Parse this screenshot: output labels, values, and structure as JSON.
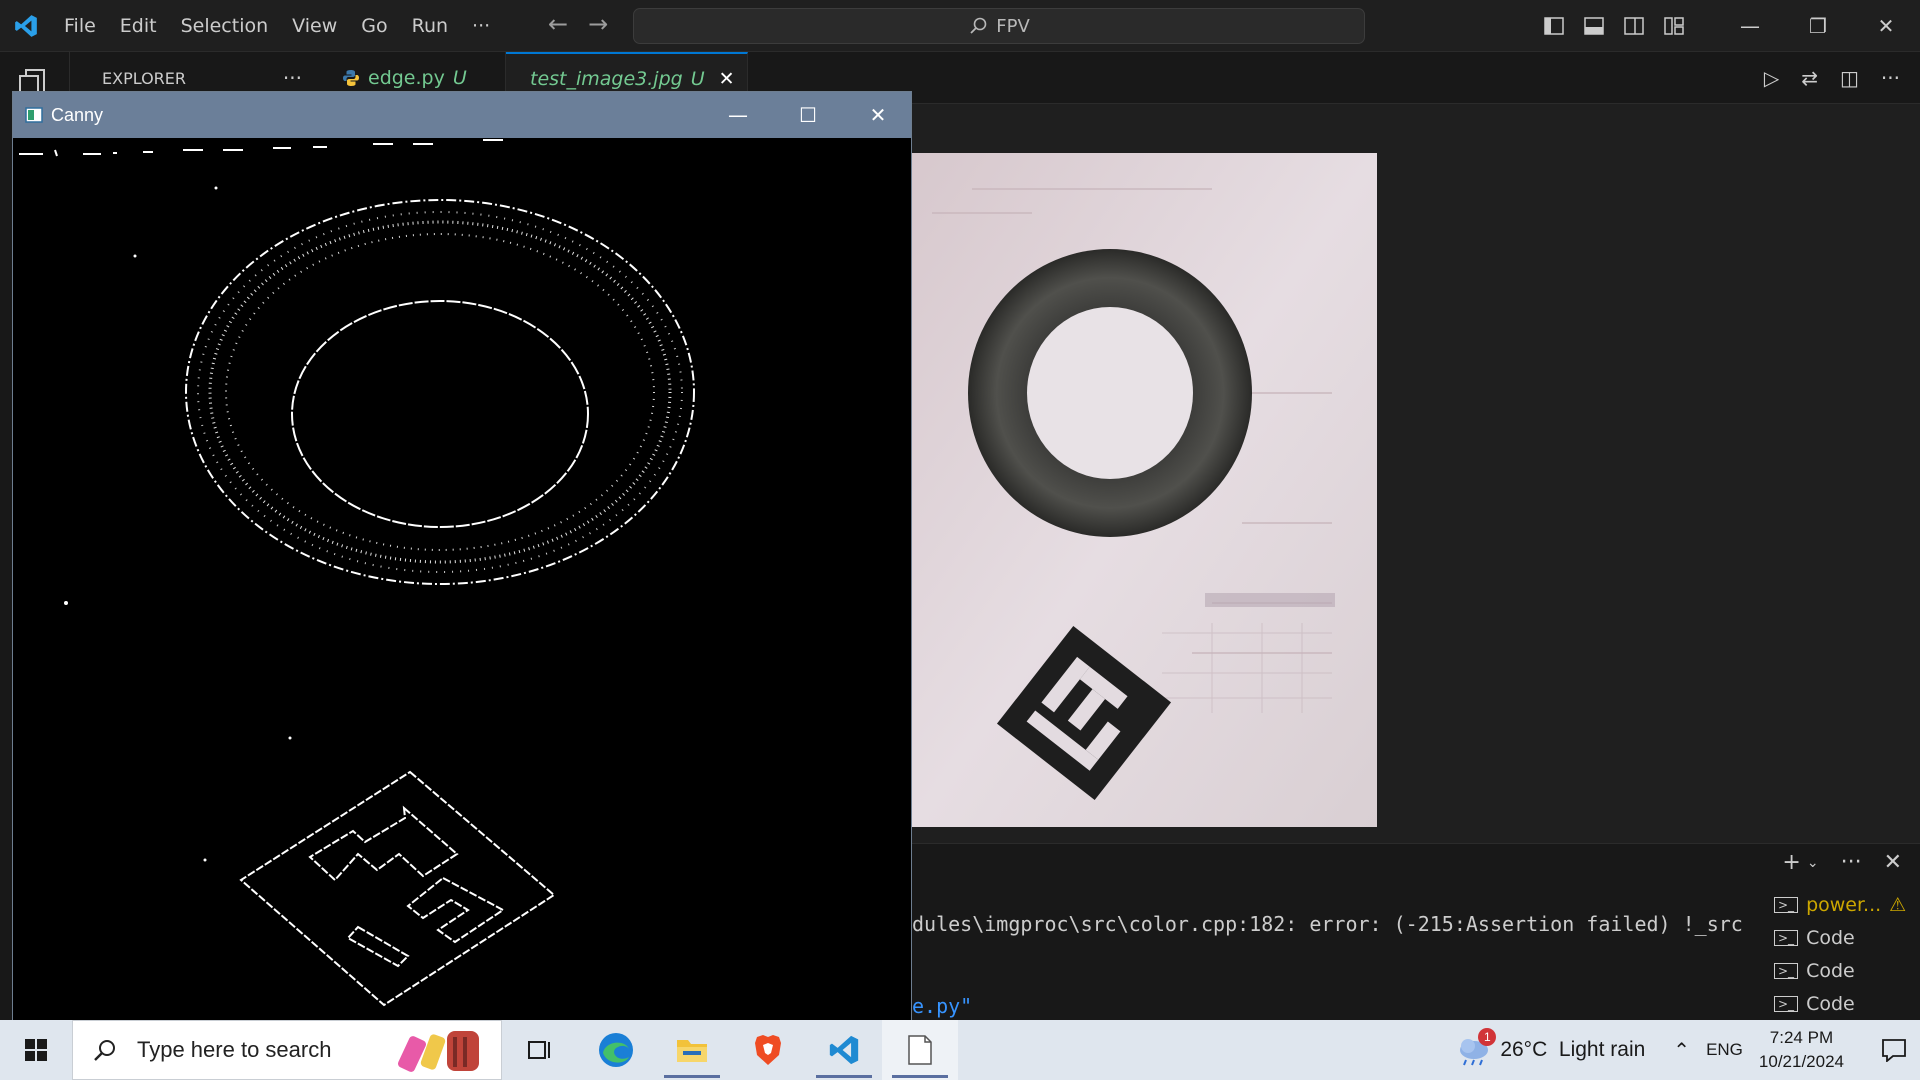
{
  "vscode": {
    "menu": [
      "File",
      "Edit",
      "Selection",
      "View",
      "Go",
      "Run",
      "···"
    ],
    "command_center": "FPV",
    "sidebar_title": "EXPLORER",
    "sidebar_more": "···",
    "tabs": [
      {
        "label": "edge.py",
        "status": "U"
      },
      {
        "label": "test_image3.jpg",
        "status": "U"
      }
    ],
    "terminal": {
      "line1": "dules\\imgproc\\src\\color.cpp:182: error: (-215:Assertion failed) !_src",
      "line2": "e.py\"",
      "instances": [
        "power...",
        "Code",
        "Code",
        "Code"
      ]
    }
  },
  "cv_window": {
    "title": "Canny"
  },
  "taskbar": {
    "search_placeholder": "Type here to search",
    "weather": "26°C  Light rain",
    "weather_badge": "1",
    "language": "ENG",
    "time": "7:24 PM",
    "date": "10/21/2024"
  },
  "colors": {
    "accent": "#0078d4",
    "untracked": "#73c991",
    "cv_titlebar": "#6b7f99"
  }
}
